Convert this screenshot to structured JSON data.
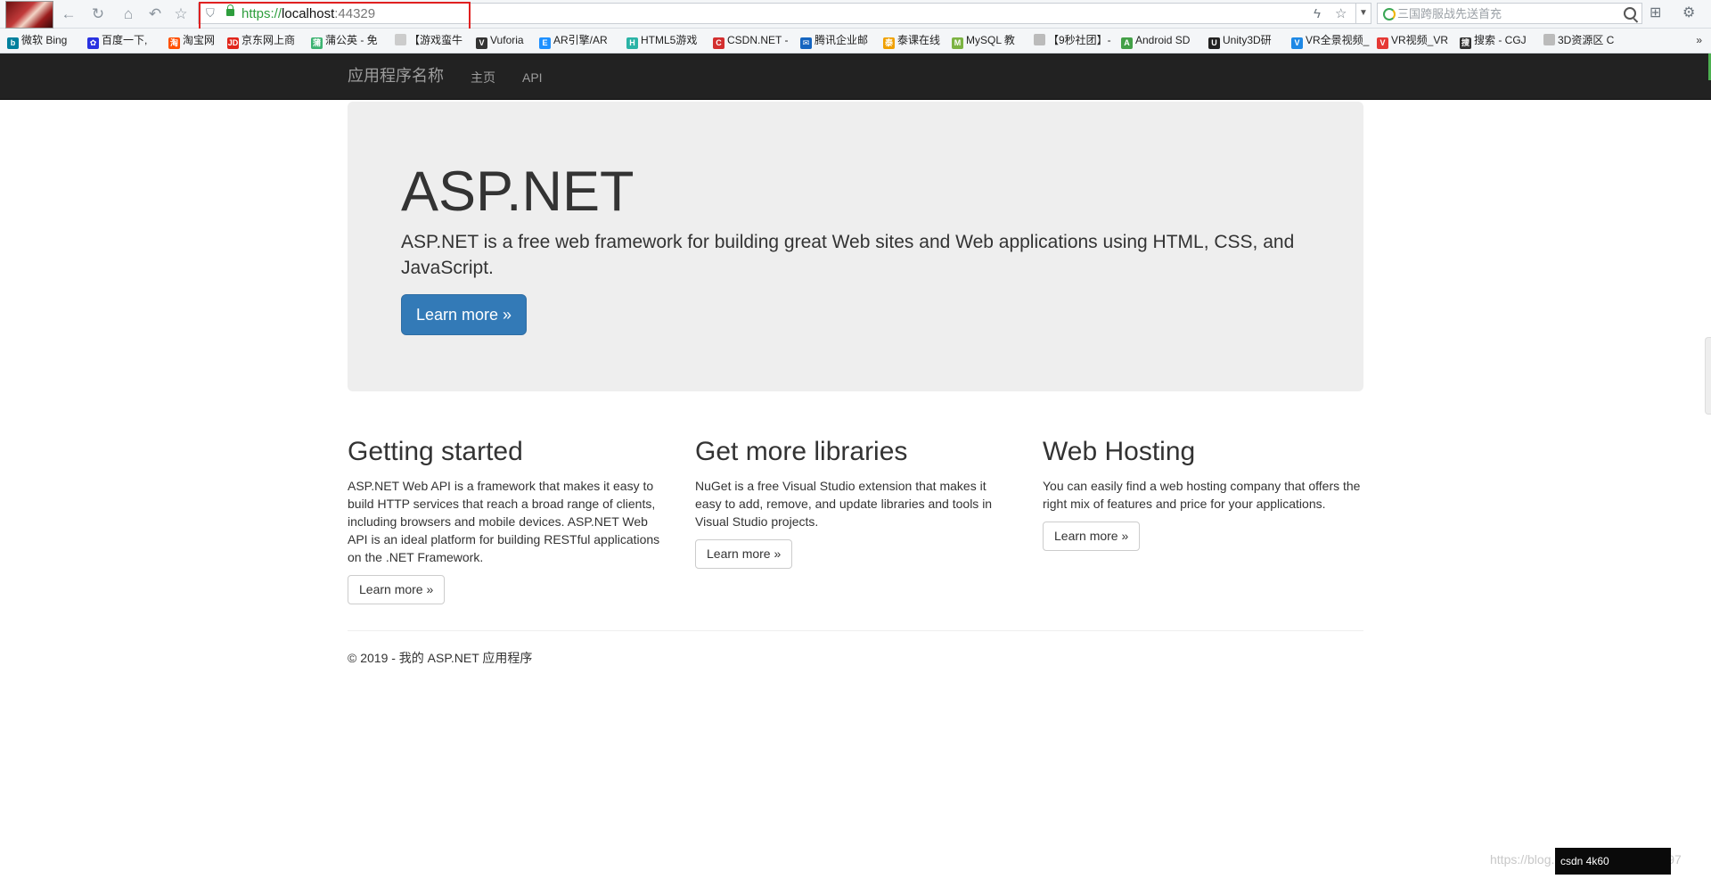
{
  "browser": {
    "nav_icons": [
      "back-icon",
      "refresh-icon",
      "home-icon",
      "undo-icon",
      "favorite-star-icon"
    ],
    "address": {
      "protocol": "https://",
      "host": "localhost",
      "port": ":44329"
    },
    "search": {
      "placeholder": "三国跨服战先送首充"
    },
    "bookmarks": [
      {
        "label": "微软 Bing",
        "icon": "bing-icon",
        "color": "#00809d",
        "glyph": "b"
      },
      {
        "label": "百度一下,",
        "icon": "baidu-icon",
        "color": "#2932e1",
        "glyph": "✿"
      },
      {
        "label": "淘宝网",
        "icon": "taobao-icon",
        "color": "#ff5000",
        "glyph": "淘"
      },
      {
        "label": "京东网上商",
        "icon": "jd-icon",
        "color": "#e1251b",
        "glyph": "JD"
      },
      {
        "label": "蒲公英 - 免",
        "icon": "pgyer-icon",
        "color": "#3cb371",
        "glyph": "蒲"
      },
      {
        "label": "【游戏蛮牛",
        "icon": "page-icon",
        "color": "#cccccc",
        "glyph": ""
      },
      {
        "label": "Vuforia",
        "icon": "vuforia-icon",
        "color": "#333333",
        "glyph": "V"
      },
      {
        "label": "AR引擎/AR",
        "icon": "ar-icon",
        "color": "#1e90ff",
        "glyph": "E"
      },
      {
        "label": "HTML5游戏",
        "icon": "html5-game-icon",
        "color": "#2ab3a6",
        "glyph": "H"
      },
      {
        "label": "CSDN.NET -",
        "icon": "csdn-icon",
        "color": "#d32f2f",
        "glyph": "C"
      },
      {
        "label": "腾讯企业邮",
        "icon": "tencent-mail-icon",
        "color": "#1565c0",
        "glyph": "✉"
      },
      {
        "label": "泰课在线",
        "icon": "taikr-icon",
        "color": "#f0a000",
        "glyph": "泰"
      },
      {
        "label": "MySQL 教",
        "icon": "mysql-icon",
        "color": "#7cb342",
        "glyph": "M"
      },
      {
        "label": "【9秒社团】-",
        "icon": "page-icon",
        "color": "#bbbbbb",
        "glyph": ""
      },
      {
        "label": "Android SD",
        "icon": "android-icon",
        "color": "#43a047",
        "glyph": "A"
      },
      {
        "label": "Unity3D研",
        "icon": "unity-icon",
        "color": "#222222",
        "glyph": "U"
      },
      {
        "label": "VR全景视频_",
        "icon": "vr-video-icon",
        "color": "#1e88e5",
        "glyph": "V"
      },
      {
        "label": "VR视频_VR",
        "icon": "vr-icon",
        "color": "#e53935",
        "glyph": "V"
      },
      {
        "label": "搜索 - CGJ",
        "icon": "cgjoy-icon",
        "color": "#333333",
        "glyph": "搜"
      },
      {
        "label": "3D资源区 C",
        "icon": "page-icon",
        "color": "#bbbbbb",
        "glyph": ""
      }
    ],
    "bookmarks_more": "»"
  },
  "navbar": {
    "brand": "应用程序名称",
    "links": [
      "主页",
      "API"
    ]
  },
  "jumbotron": {
    "title": "ASP.NET",
    "lead": "ASP.NET is a free web framework for building great Web sites and Web applications using HTML, CSS, and JavaScript.",
    "button": "Learn more »"
  },
  "columns": [
    {
      "title": "Getting started",
      "text": "ASP.NET Web API is a framework that makes it easy to build HTTP services that reach a broad range of clients, including browsers and mobile devices. ASP.NET Web API is an ideal platform for building RESTful applications on the .NET Framework.",
      "button": "Learn more »"
    },
    {
      "title": "Get more libraries",
      "text": "NuGet is a free Visual Studio extension that makes it easy to add, remove, and update libraries and tools in Visual Studio projects.",
      "button": "Learn more »"
    },
    {
      "title": "Web Hosting",
      "text": "You can easily find a web hosting company that offers the right mix of features and price for your applications.",
      "button": "Learn more »"
    }
  ],
  "footer": {
    "text": "© 2019 - 我的 ASP.NET 应用程序"
  },
  "watermark": {
    "text": "https://blog.csdn.net/qq_39350697",
    "badge": "csdn 4k60"
  },
  "colors": {
    "navbar_bg": "#222222",
    "primary": "#337ab7",
    "jumbotron_bg": "#eeeeee",
    "secure_green": "#2e9e3d",
    "highlight_red": "#e02020"
  }
}
